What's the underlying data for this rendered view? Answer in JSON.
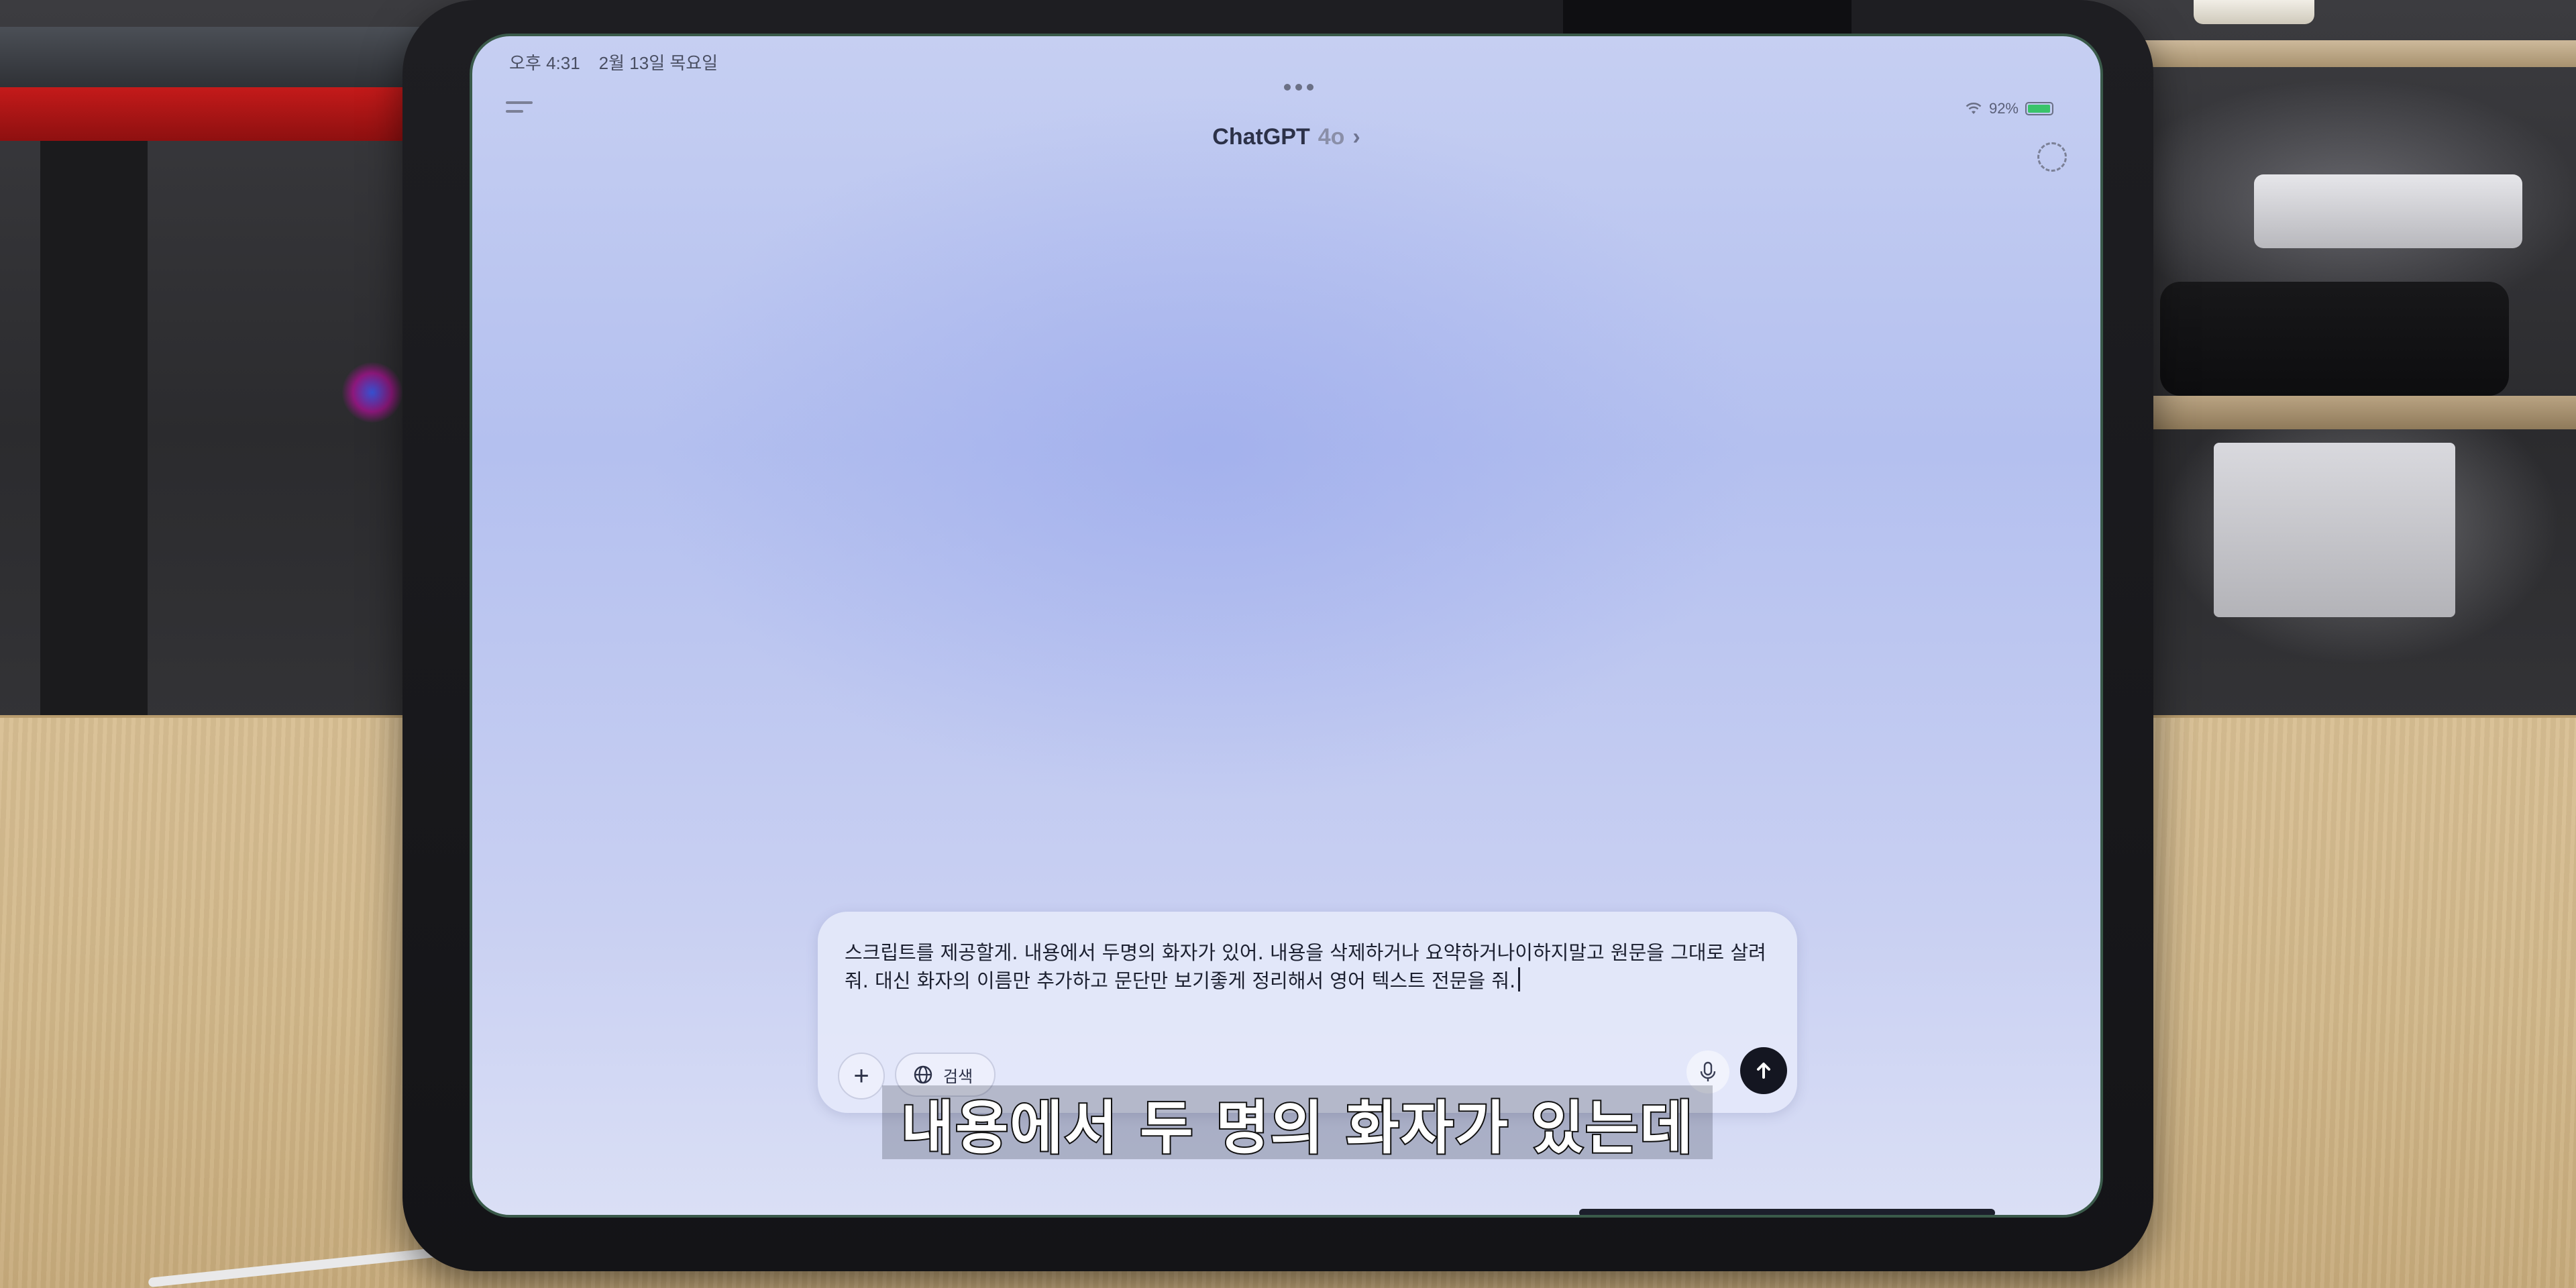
{
  "status_bar": {
    "time": "오후 4:31",
    "date": "2월 13일 목요일",
    "battery_percent": "92%",
    "battery_level": 0.92
  },
  "header": {
    "app_name": "ChatGPT",
    "model": "4o",
    "chevron": "›"
  },
  "composer": {
    "input_text": "스크립트를 제공할게. 내용에서 두명의 화자가 있어. 내용을 삭제하거나 요약하거나이하지말고 원문을 그대로 살려줘. 대신 화자의 이름만 추가하고 문단만 보기좋게 정리해서 영어 텍스트 전문을 줘.",
    "plus_label": "+",
    "search_label": "검색"
  },
  "subtitle": {
    "text": "내용에서 두 명의 화자가 있는데"
  },
  "icons": {
    "sidebar": "sidebar-toggle-icon",
    "temporary_chat": "temporary-chat-icon",
    "globe": "globe-icon",
    "mic": "microphone-icon",
    "send": "send-arrow-icon",
    "wifi": "wifi-icon",
    "battery": "battery-icon"
  },
  "colors": {
    "battery_fill": "#39c36a",
    "send_button": "#141621"
  }
}
